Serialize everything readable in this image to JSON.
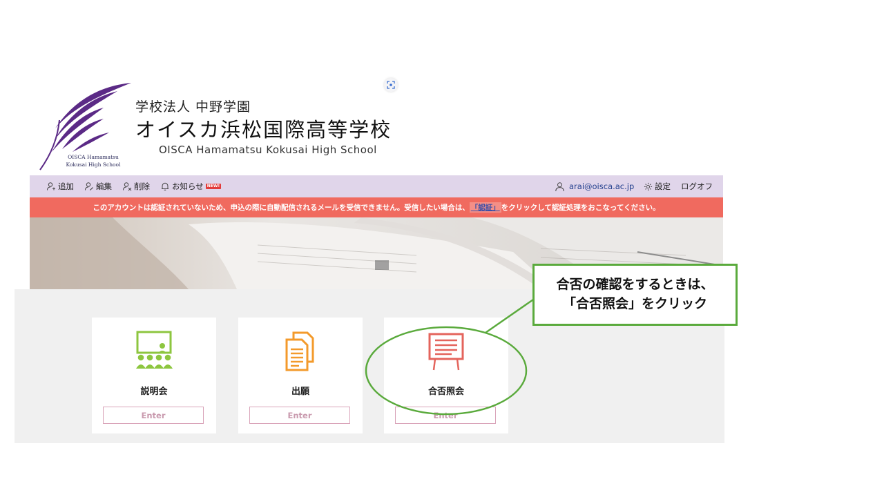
{
  "header": {
    "org_name": "学校法人 中野学園",
    "school_name_jp": "オイスカ浜松国際高等学校",
    "school_name_en": "OISCA Hamamatsu Kokusai High School",
    "logo_text_line1": "OISCA Hamamatsu",
    "logo_text_line2": "Kokusai High School",
    "brand_color": "#5b2a86"
  },
  "nav": {
    "add": "追加",
    "edit": "編集",
    "delete": "削除",
    "notice": "お知らせ",
    "new_badge": "NEW!",
    "email": "arai@oisca.ac.jp",
    "settings": "設定",
    "logout": "ログオフ",
    "bar_color": "#e0d5ea"
  },
  "alert": {
    "text_before": "このアカウントは認証されていないため、申込の際に自動配信されるメールを受信できません。受信したい場合は、",
    "link": "「認証」",
    "text_after": "をクリックして認証処理をおこなってください。",
    "color": "#f06a5f"
  },
  "cards": [
    {
      "title": "説明会",
      "button": "Enter",
      "icon": "presentation-icon",
      "color": "#8dc63f"
    },
    {
      "title": "出願",
      "button": "Enter",
      "icon": "documents-icon",
      "color": "#f39a2b"
    },
    {
      "title": "合否照会",
      "button": "Enter",
      "icon": "results-board-icon",
      "color": "#e4645c"
    }
  ],
  "annotation": {
    "line1": "合否の確認をするときは、",
    "line2": "「合否照会」をクリック",
    "color": "#5aaa3c"
  }
}
